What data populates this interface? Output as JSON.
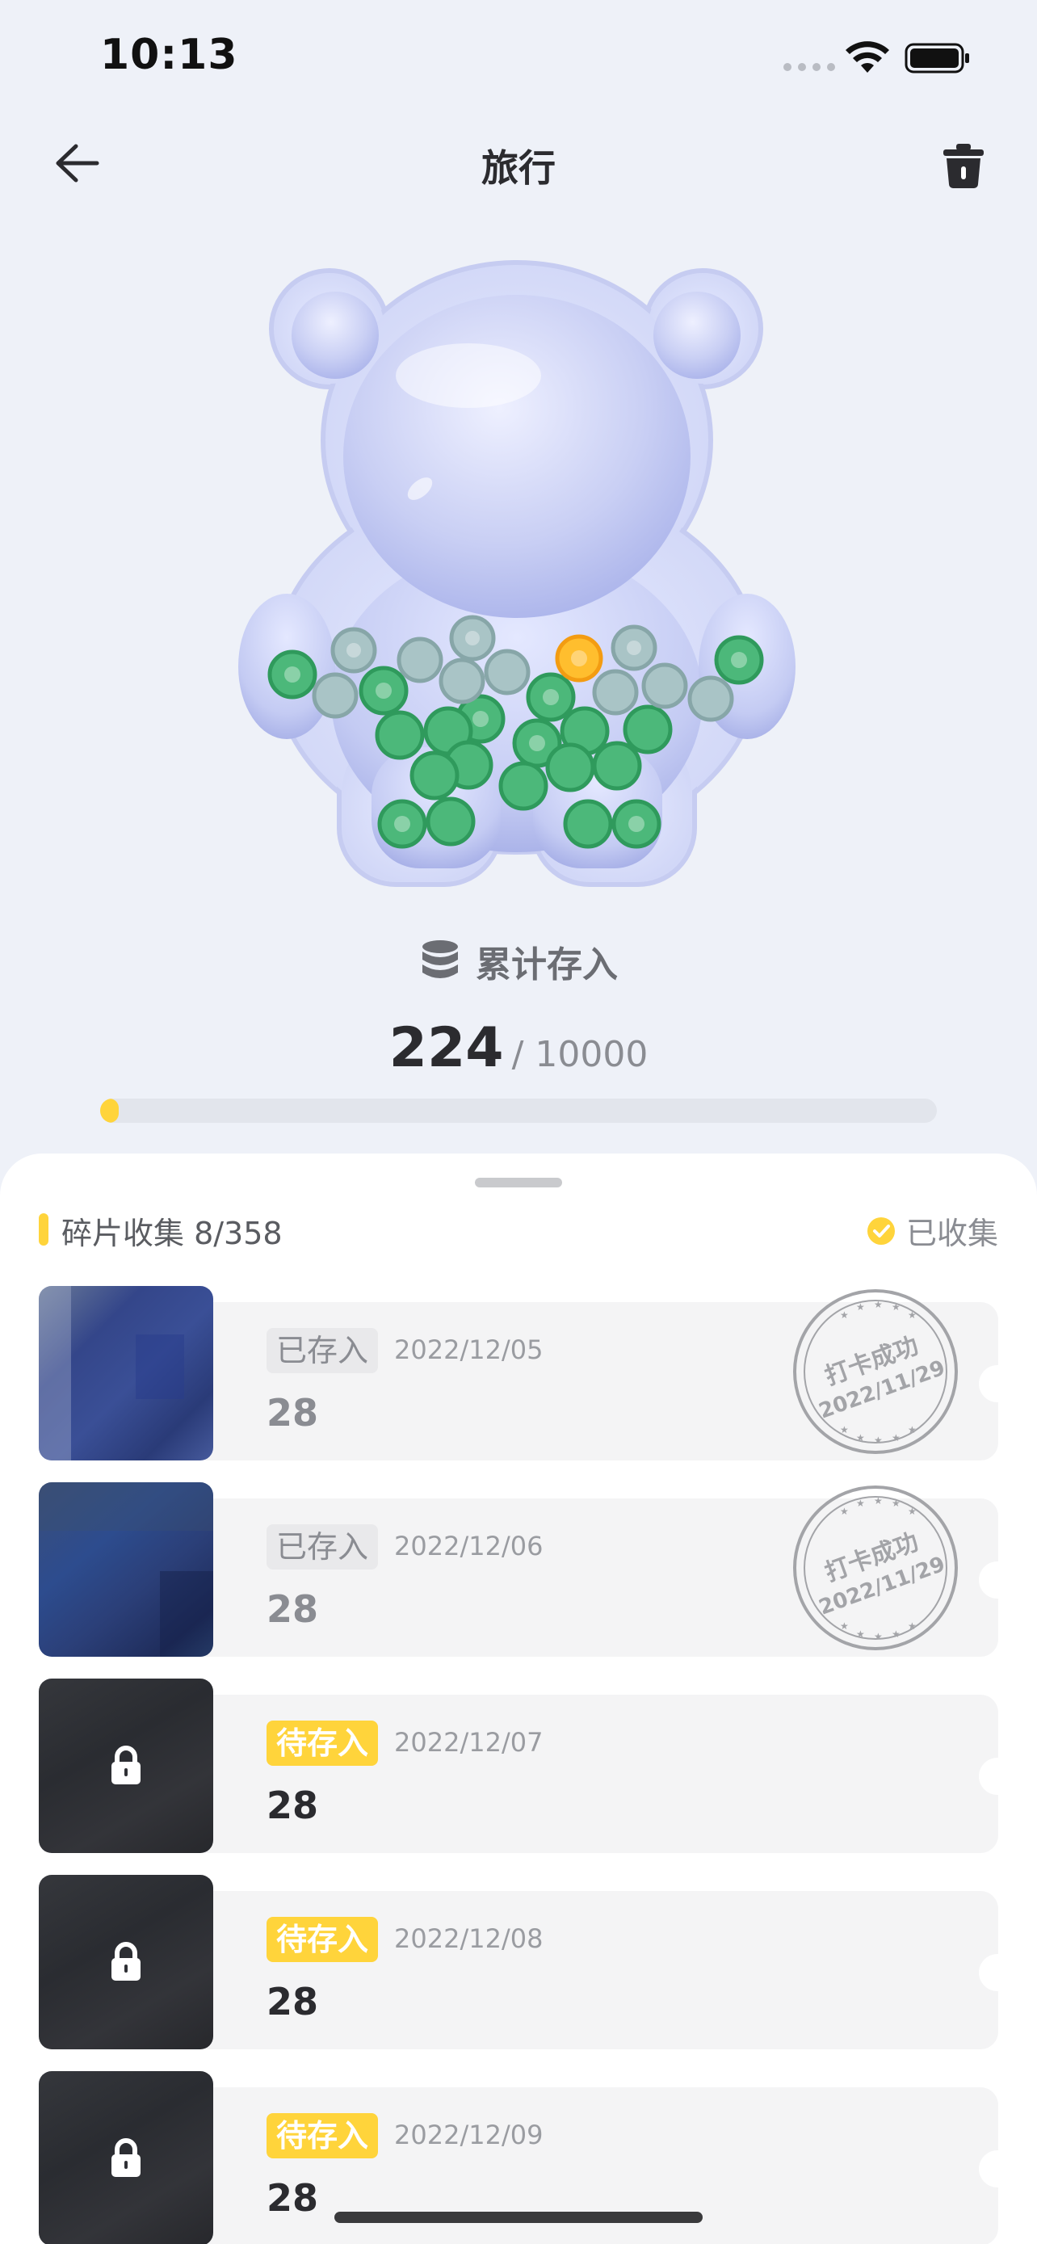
{
  "status_bar": {
    "time": "10:13"
  },
  "nav": {
    "title": "旅行",
    "back_icon": "arrow-left-icon",
    "trash_icon": "trash-icon"
  },
  "summary": {
    "label": "累计存入",
    "current": "224",
    "target": "/ 10000",
    "progress_fraction": 0.0224,
    "accent_color": "#ffd43b"
  },
  "sheet": {
    "title": "碎片收集 8/358",
    "filter_label": "已收集"
  },
  "stamp": {
    "line1": "打卡成功",
    "line2": "2022/11/29"
  },
  "rows": [
    {
      "status": "已存入",
      "date": "2022/12/05",
      "amount": "28",
      "locked": false
    },
    {
      "status": "已存入",
      "date": "2022/12/06",
      "amount": "28",
      "locked": false
    },
    {
      "status": "待存入",
      "date": "2022/12/07",
      "amount": "28",
      "locked": true
    },
    {
      "status": "待存入",
      "date": "2022/12/08",
      "amount": "28",
      "locked": true
    },
    {
      "status": "待存入",
      "date": "2022/12/09",
      "amount": "28",
      "locked": true
    }
  ]
}
